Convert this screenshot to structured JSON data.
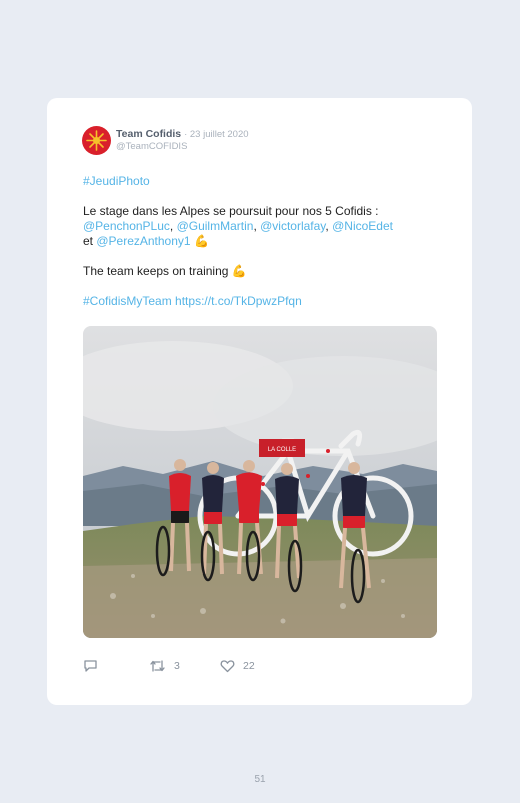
{
  "tweet": {
    "author_name": "Team Cofidis",
    "date": "· 23 juillet 2020",
    "handle": "@TeamCOFIDIS",
    "hashtag_line": "#JeudiPhoto",
    "line1_text": "Le stage dans les Alpes se poursuit pour nos 5 Cofidis :",
    "mentions": [
      "@PenchonPLuc",
      "@GuilmMartin",
      "@victorlafay",
      "@NicoEdet",
      "@PerezAnthony1"
    ],
    "sep": ", ",
    "et": " et ",
    "emoji": "💪",
    "line3_text": "The team keeps on training",
    "hashtag2": "#CofidisMyTeam",
    "url": "https://t.co/TkDpwzPfqn",
    "banner_text": "LA COLLE",
    "retweet_count": "3",
    "like_count": "22"
  },
  "page_number": "51",
  "colors": {
    "link": "#55b4e6",
    "background": "#e8ecf3",
    "card": "#ffffff",
    "brand_red": "#d9202b"
  },
  "icons": [
    "cofidis-logo-icon",
    "reply-icon",
    "retweet-icon",
    "heart-icon"
  ]
}
